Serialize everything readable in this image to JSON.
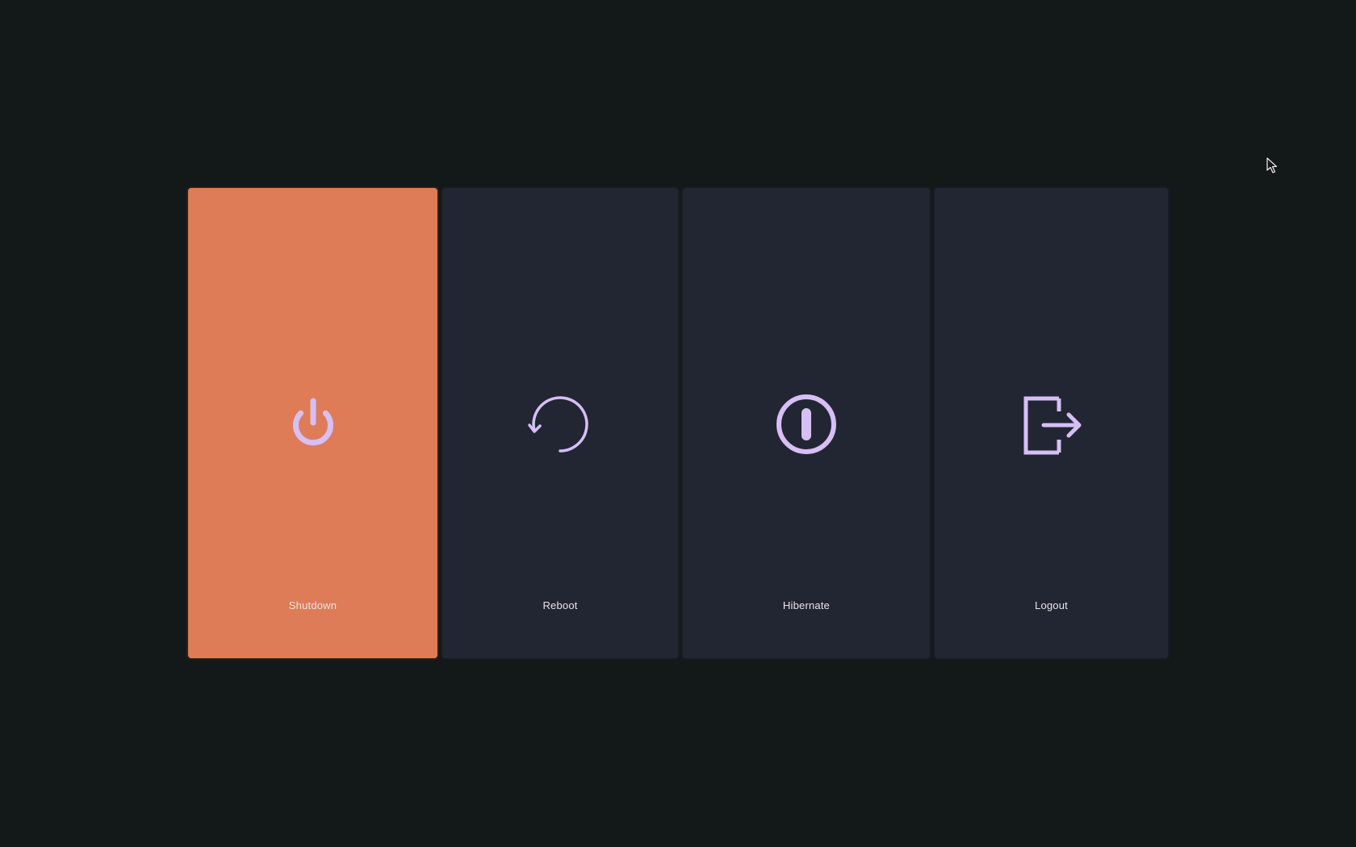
{
  "theme": {
    "background": "#131919",
    "panel": "#222632",
    "selected_panel": "#dd7c57",
    "icon_color": "#d7bff5",
    "label_color": "#e6e6ea"
  },
  "actions": [
    {
      "label": "Shutdown",
      "icon": "power-icon",
      "selected": true
    },
    {
      "label": "Reboot",
      "icon": "restart-icon",
      "selected": false
    },
    {
      "label": "Hibernate",
      "icon": "hibernate-icon",
      "selected": false
    },
    {
      "label": "Logout",
      "icon": "logout-icon",
      "selected": false
    }
  ],
  "cursor": {
    "icon": "mouse-pointer-icon"
  }
}
